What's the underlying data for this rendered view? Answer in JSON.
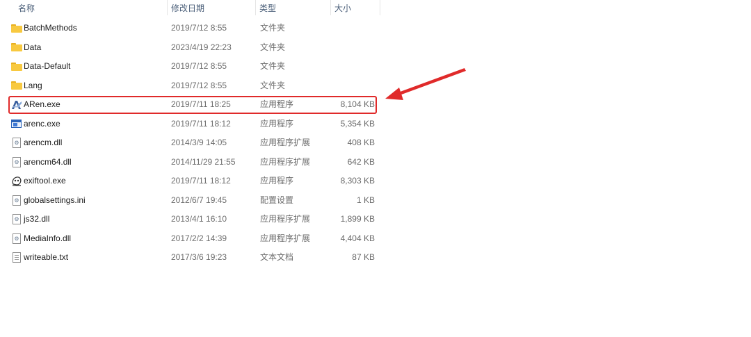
{
  "columns": {
    "name": "名称",
    "date": "修改日期",
    "type": "类型",
    "size": "大小"
  },
  "files": [
    {
      "name": "BatchMethods",
      "date": "2019/7/12 8:55",
      "type": "文件夹",
      "size": "",
      "icon": "folder-icon"
    },
    {
      "name": "Data",
      "date": "2023/4/19 22:23",
      "type": "文件夹",
      "size": "",
      "icon": "folder-icon"
    },
    {
      "name": "Data-Default",
      "date": "2019/7/12 8:55",
      "type": "文件夹",
      "size": "",
      "icon": "folder-icon"
    },
    {
      "name": "Lang",
      "date": "2019/7/12 8:55",
      "type": "文件夹",
      "size": "",
      "icon": "folder-icon"
    },
    {
      "name": "ARen.exe",
      "date": "2019/7/11 18:25",
      "type": "应用程序",
      "size": "8,104 KB",
      "icon": "aren-app-icon"
    },
    {
      "name": "arenc.exe",
      "date": "2019/7/11 18:12",
      "type": "应用程序",
      "size": "5,354 KB",
      "icon": "application-window-icon"
    },
    {
      "name": "arencm.dll",
      "date": "2014/3/9 14:05",
      "type": "应用程序扩展",
      "size": "408 KB",
      "icon": "dll-file-icon"
    },
    {
      "name": "arencm64.dll",
      "date": "2014/11/29 21:55",
      "type": "应用程序扩展",
      "size": "642 KB",
      "icon": "dll-file-icon"
    },
    {
      "name": "exiftool.exe",
      "date": "2019/7/11 18:12",
      "type": "应用程序",
      "size": "8,303 KB",
      "icon": "exiftool-app-icon"
    },
    {
      "name": "globalsettings.ini",
      "date": "2012/6/7 19:45",
      "type": "配置设置",
      "size": "1 KB",
      "icon": "ini-file-icon"
    },
    {
      "name": "js32.dll",
      "date": "2013/4/1 16:10",
      "type": "应用程序扩展",
      "size": "1,899 KB",
      "icon": "dll-file-icon"
    },
    {
      "name": "MediaInfo.dll",
      "date": "2017/2/2 14:39",
      "type": "应用程序扩展",
      "size": "4,404 KB",
      "icon": "dll-file-icon"
    },
    {
      "name": "writeable.txt",
      "date": "2017/3/6 19:23",
      "type": "文本文档",
      "size": "87 KB",
      "icon": "text-file-icon"
    }
  ],
  "colors": {
    "highlight": "#e02a2a",
    "folder": "#f8c940",
    "header_text": "#4c607a"
  }
}
